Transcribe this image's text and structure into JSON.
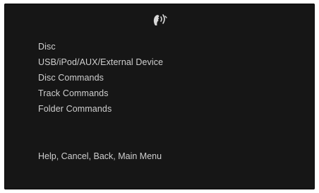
{
  "screen": {
    "icon": "voice-command-icon",
    "menu_items": [
      "Disc",
      "USB/iPod/AUX/External Device",
      "Disc Commands",
      "Track Commands",
      "Folder Commands"
    ],
    "help_text": "Help, Cancel, Back, Main Menu",
    "colors": {
      "background": "#161616",
      "text": "#cfcfcf"
    }
  }
}
